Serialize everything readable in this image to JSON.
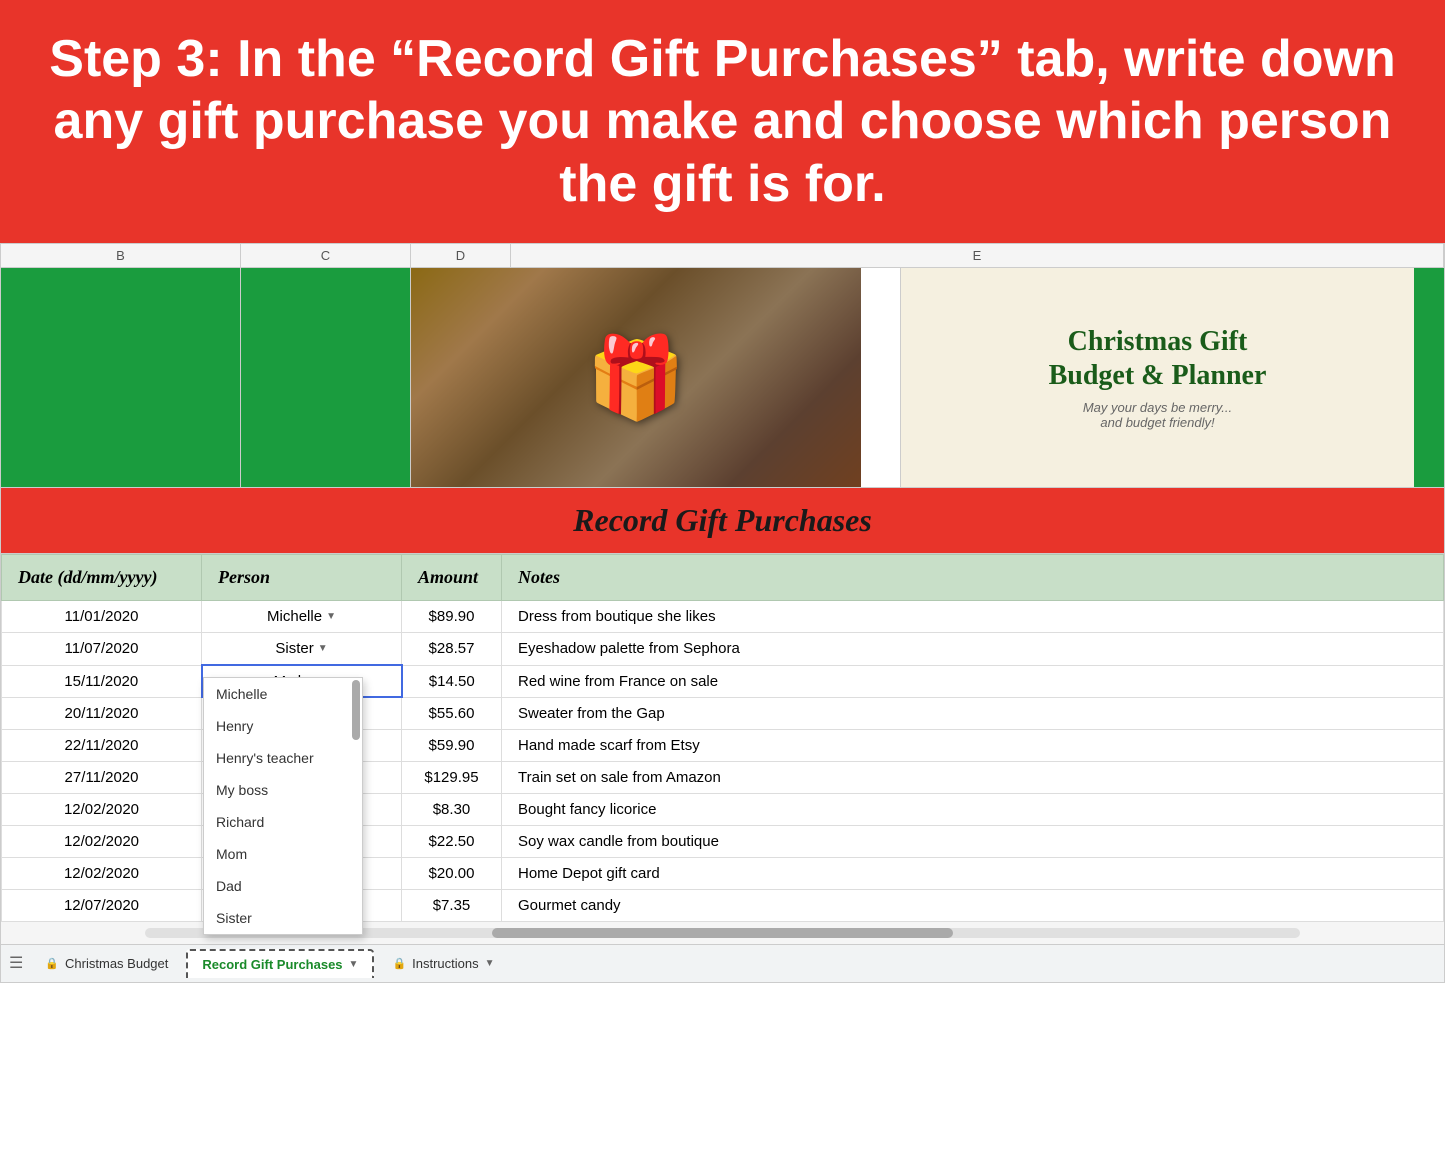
{
  "header": {
    "banner_text": "Step 3: In the “Record Gift Purchases” tab, write down any gift purchase you make and choose which person the gift is for."
  },
  "spreadsheet": {
    "col_headers": [
      "B",
      "C",
      "D",
      "E"
    ],
    "logo": {
      "title": "Christmas Gift\nBudget & Planner",
      "subtitle": "May your days be merry...\nand budget friendly!"
    },
    "record_header": "Record Gift Purchases",
    "table": {
      "columns": [
        "Date (dd/mm/yyyy)",
        "Person",
        "Amount",
        "Notes"
      ],
      "rows": [
        {
          "date": "11/01/2020",
          "person": "Michelle",
          "has_dropdown": true,
          "amount": "$89.90",
          "notes": "Dress from boutique she likes"
        },
        {
          "date": "11/07/2020",
          "person": "Sister",
          "has_dropdown": true,
          "amount": "$28.57",
          "notes": "Eyeshadow palette from Sephora"
        },
        {
          "date": "15/11/2020",
          "person": "My boss",
          "has_dropdown": false,
          "active": true,
          "amount": "$14.50",
          "notes": "Red wine from France on sale"
        },
        {
          "date": "20/11/2020",
          "person": "",
          "has_dropdown": false,
          "amount": "$55.60",
          "notes": "Sweater from the Gap"
        },
        {
          "date": "22/11/2020",
          "person": "",
          "has_dropdown": false,
          "amount": "$59.90",
          "notes": "Hand made scarf from Etsy"
        },
        {
          "date": "27/11/2020",
          "person": "",
          "has_dropdown": false,
          "amount": "$129.95",
          "notes": "Train set on sale from Amazon"
        },
        {
          "date": "12/02/2020",
          "person": "",
          "has_dropdown": false,
          "amount": "$8.30",
          "notes": "Bought fancy licorice"
        },
        {
          "date": "12/02/2020",
          "person": "",
          "has_dropdown": false,
          "amount": "$22.50",
          "notes": "Soy wax candle from boutique"
        },
        {
          "date": "12/02/2020",
          "person": "",
          "has_dropdown": false,
          "amount": "$20.00",
          "notes": "Home Depot gift card"
        },
        {
          "date": "12/07/2020",
          "person": "",
          "has_dropdown": false,
          "amount": "$7.35",
          "notes": "Gourmet candy"
        }
      ]
    },
    "dropdown_options": [
      "Michelle",
      "Henry",
      "Henry's teacher",
      "My boss",
      "Richard",
      "Mom",
      "Dad",
      "Sister"
    ]
  },
  "tabs": {
    "christmas_budget": "Christmas Budget",
    "record_gift": "Record Gift Purchases",
    "instructions": "Instructions"
  }
}
